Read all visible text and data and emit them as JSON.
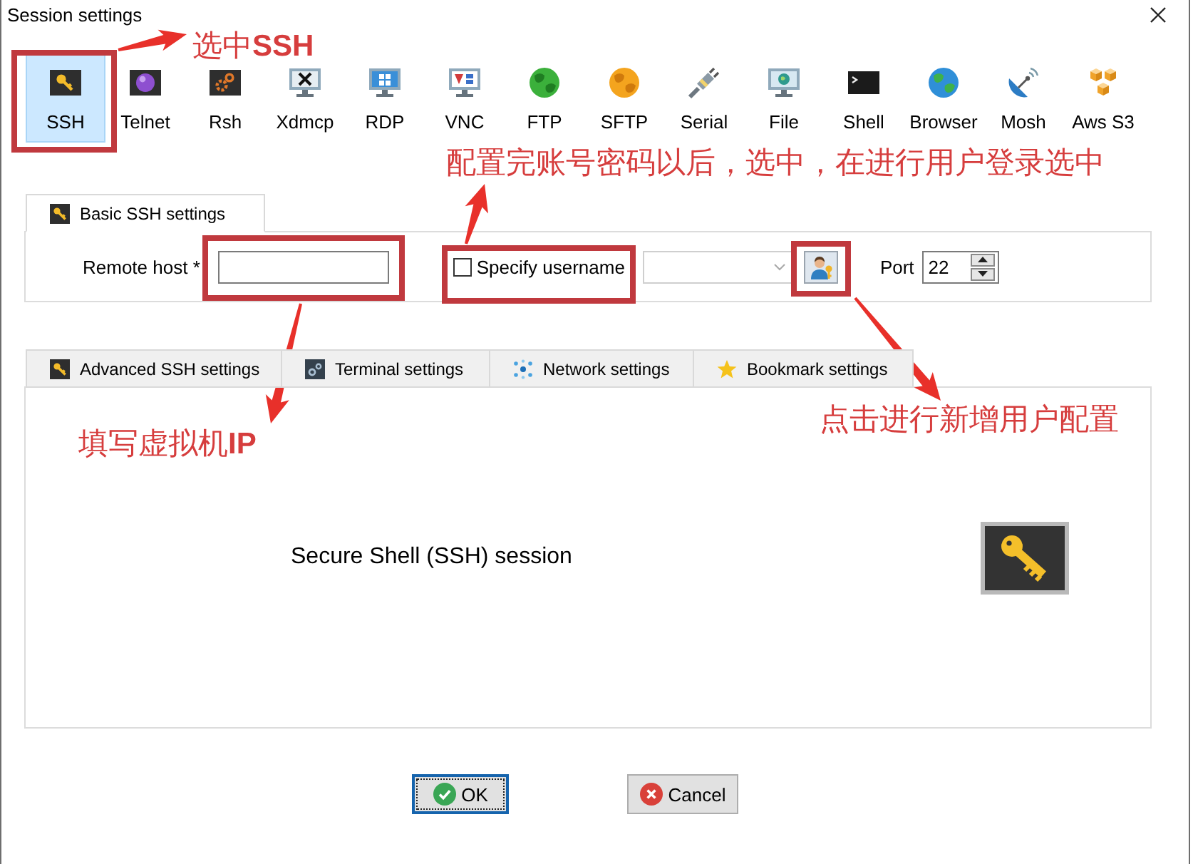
{
  "window": {
    "title": "Session settings"
  },
  "session_types": [
    {
      "label": "SSH",
      "kind": "ssh",
      "selected": true
    },
    {
      "label": "Telnet",
      "kind": "telnet",
      "selected": false
    },
    {
      "label": "Rsh",
      "kind": "rsh",
      "selected": false
    },
    {
      "label": "Xdmcp",
      "kind": "xdmcp",
      "selected": false
    },
    {
      "label": "RDP",
      "kind": "rdp",
      "selected": false
    },
    {
      "label": "VNC",
      "kind": "vnc",
      "selected": false
    },
    {
      "label": "FTP",
      "kind": "ftp",
      "selected": false
    },
    {
      "label": "SFTP",
      "kind": "sftp",
      "selected": false
    },
    {
      "label": "Serial",
      "kind": "serial",
      "selected": false
    },
    {
      "label": "File",
      "kind": "file",
      "selected": false
    },
    {
      "label": "Shell",
      "kind": "shell",
      "selected": false
    },
    {
      "label": "Browser",
      "kind": "browser",
      "selected": false
    },
    {
      "label": "Mosh",
      "kind": "mosh",
      "selected": false
    },
    {
      "label": "Aws S3",
      "kind": "s3",
      "selected": false
    }
  ],
  "basic_tab": {
    "label": "Basic SSH settings",
    "selected": true
  },
  "basic_settings": {
    "remote_host_label": "Remote host *",
    "specify_username": {
      "label": "Specify username",
      "checked": false
    },
    "port_label": "Port",
    "port_value": "22"
  },
  "advanced_tabs": [
    {
      "label": "Advanced SSH settings",
      "kind": "ssh",
      "selected": false
    },
    {
      "label": "Terminal settings",
      "kind": "terminal",
      "selected": false
    },
    {
      "label": "Network settings",
      "kind": "network",
      "selected": false
    },
    {
      "label": "Bookmark settings",
      "kind": "bookmark",
      "selected": false
    }
  ],
  "session_description": "Secure Shell (SSH) session",
  "buttons": [
    {
      "label": "OK",
      "kind": "ok",
      "focused": true
    },
    {
      "label": "Cancel",
      "kind": "cancel",
      "focused": false
    }
  ],
  "annotations": [
    {
      "text": "选中**SSH**"
    },
    {
      "text": "配置完账号密码以后，选中，在进行用户登录选中"
    },
    {
      "text": "填写虚拟机**IP**"
    },
    {
      "text": "点击进行新增用户配置"
    }
  ]
}
